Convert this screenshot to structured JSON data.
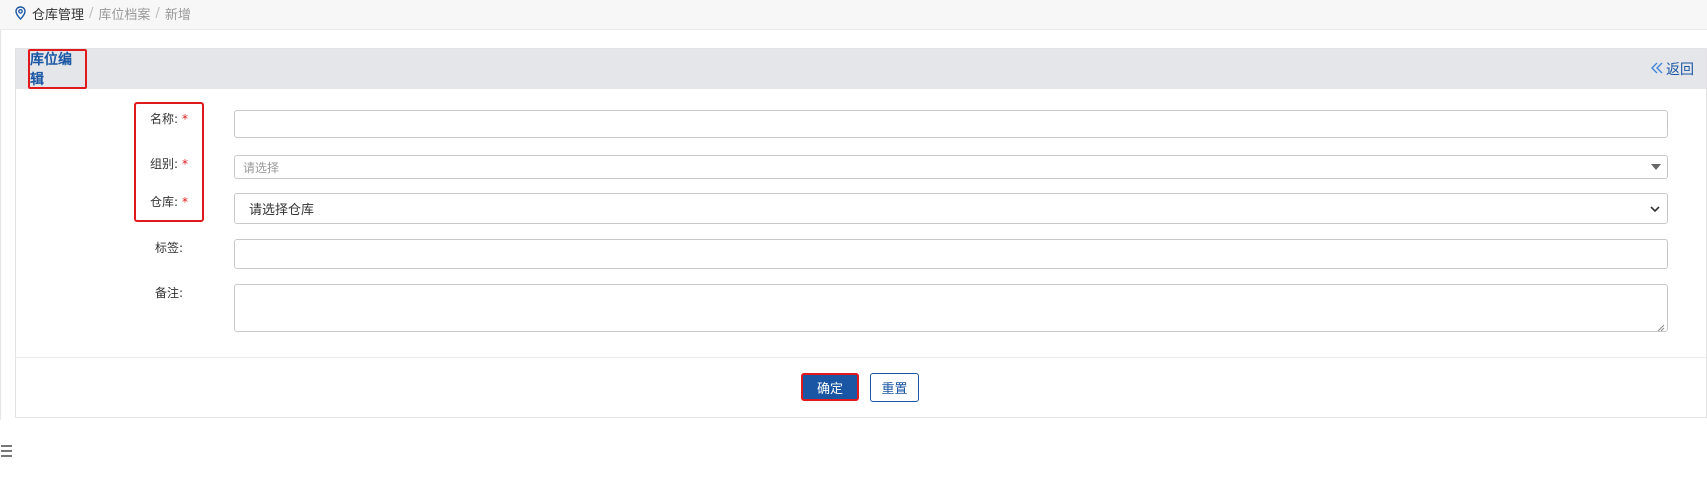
{
  "breadcrumb": {
    "items": [
      "仓库管理",
      "库位档案",
      "新增"
    ],
    "separator": "/"
  },
  "panel": {
    "title": "库位编辑",
    "back_label": "返回"
  },
  "form": {
    "name": {
      "label": "名称:",
      "required": "*",
      "value": ""
    },
    "group": {
      "label": "组别:",
      "required": "*",
      "placeholder": "请选择"
    },
    "warehouse": {
      "label": "仓库:",
      "required": "*",
      "selected": "请选择仓库"
    },
    "tag": {
      "label": "标签:",
      "value": ""
    },
    "remark": {
      "label": "备注:",
      "value": ""
    }
  },
  "actions": {
    "confirm_label": "确定",
    "reset_label": "重置"
  },
  "colors": {
    "primary": "#1a56a3",
    "highlight": "#e0191c",
    "header_bg": "#e4e6ea"
  }
}
